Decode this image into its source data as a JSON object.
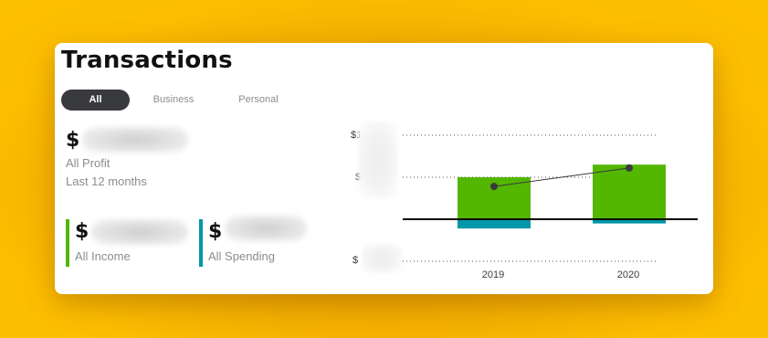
{
  "header": {
    "title": "Transactions"
  },
  "tabs": [
    {
      "label": "All",
      "active": true
    },
    {
      "label": "Business",
      "active": false
    },
    {
      "label": "Personal",
      "active": false
    }
  ],
  "summary": {
    "profit": {
      "currency": "$",
      "label": "All Profit",
      "period": "Last 12 months"
    },
    "income": {
      "currency": "$",
      "label": "All Income",
      "color": "#53b700"
    },
    "spending": {
      "currency": "$",
      "label": "All Spending",
      "color": "#0097a8"
    }
  },
  "chart_data": {
    "type": "bar",
    "categories": [
      "2019",
      "2020"
    ],
    "y_tick_labels": [
      "$1",
      "$",
      "$"
    ],
    "series": [
      {
        "name": "",
        "color": "#53b700",
        "values": [
          1.0,
          1.3
        ]
      },
      {
        "name": "",
        "color": "#0097a8",
        "values": [
          -0.22,
          -0.1
        ]
      }
    ],
    "line": {
      "color": "#393a3d",
      "values": [
        0.78,
        1.22
      ]
    },
    "ylim": [
      -1,
      2
    ],
    "grid": true
  }
}
